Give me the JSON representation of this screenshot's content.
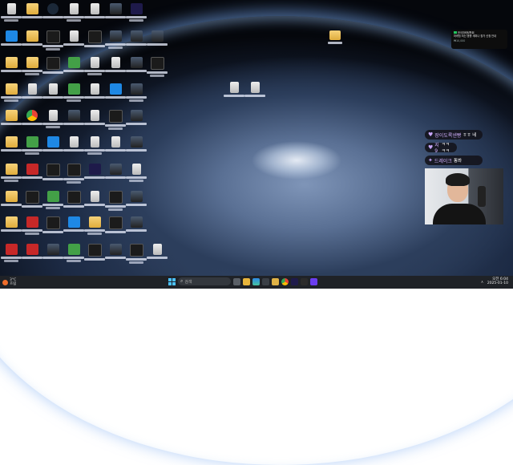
{
  "desktop": {
    "folder_top_right_label": "새 폴더",
    "file_labels": [
      "",
      ""
    ]
  },
  "notification": {
    "line1": "한국마케팅학회",
    "line2": "마케팅 최신 동향 세미나 참가 신청 안내",
    "line3": "₩10,000"
  },
  "chat": [
    {
      "icon": "♥",
      "name": "장이도록넨빵",
      "msg": "ㅎㅎ 네"
    },
    {
      "icon": "♥",
      "name": "지9",
      "msg": "ㅋㅋ ㅋㅋ"
    },
    {
      "icon": "✦",
      "name": "드레이크",
      "msg": "통봐"
    }
  ],
  "taskbar": {
    "weather_temp": "3°C",
    "weather_desc": "흐림",
    "search_placeholder": "검색",
    "time": "오전 6:04",
    "date": "2025-01-10",
    "sys_label": "ㅅ"
  }
}
